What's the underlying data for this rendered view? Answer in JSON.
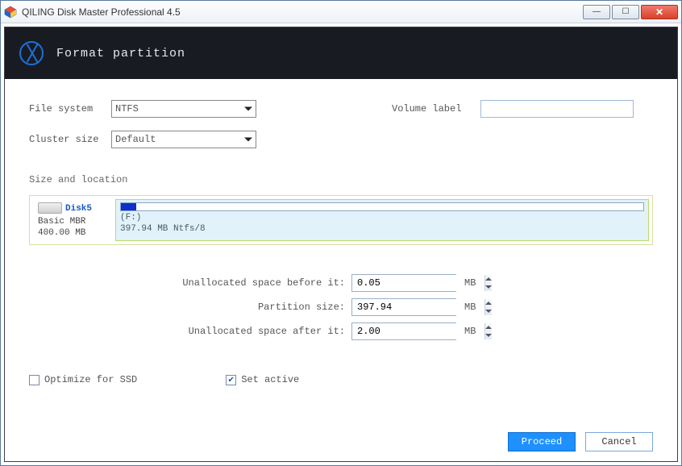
{
  "window": {
    "title": "QILING Disk Master Professional 4.5"
  },
  "header": {
    "title": "Format partition"
  },
  "form": {
    "filesystem_label": "File system",
    "filesystem_value": "NTFS",
    "cluster_label": "Cluster size",
    "cluster_value": "Default",
    "volume_label_label": "Volume label",
    "volume_label_value": ""
  },
  "size_section_heading": "Size and location",
  "disk": {
    "name": "Disk5",
    "type": "Basic MBR",
    "size": "400.00 MB",
    "partition_letter": "(F:)",
    "partition_detail": "397.94 MB Ntfs/8"
  },
  "size": {
    "before_label": "Unallocated space before it:",
    "before_value": "0.05",
    "partition_label": "Partition size:",
    "partition_value": "397.94",
    "after_label": "Unallocated space after it:",
    "after_value": "2.00",
    "unit": "MB"
  },
  "options": {
    "optimize_ssd_label": "Optimize for SSD",
    "optimize_ssd_checked": false,
    "set_active_label": "Set active",
    "set_active_checked": true
  },
  "buttons": {
    "proceed": "Proceed",
    "cancel": "Cancel"
  }
}
